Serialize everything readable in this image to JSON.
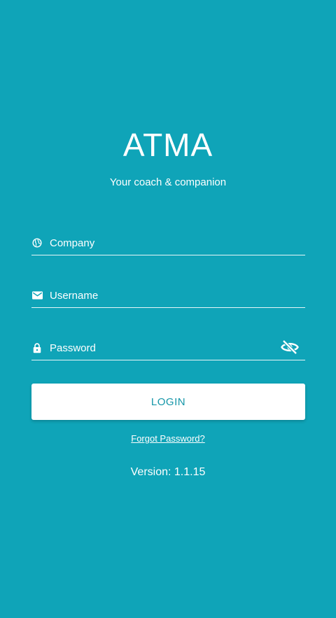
{
  "app": {
    "title": "ATMA",
    "tagline": "Your coach & companion"
  },
  "form": {
    "company": {
      "placeholder": "Company",
      "value": "",
      "icon": "globe-icon"
    },
    "username": {
      "placeholder": "Username",
      "value": "",
      "icon": "mail-icon"
    },
    "password": {
      "placeholder": "Password",
      "value": "",
      "icon": "lock-icon",
      "toggle_icon": "eye-off-icon"
    }
  },
  "actions": {
    "login_label": "LOGIN",
    "forgot_label": "Forgot Password?"
  },
  "footer": {
    "version": "Version: 1.1.15"
  },
  "colors": {
    "background": "#0fa4b8",
    "button_text": "#1596a8",
    "button_bg": "#ffffff"
  }
}
